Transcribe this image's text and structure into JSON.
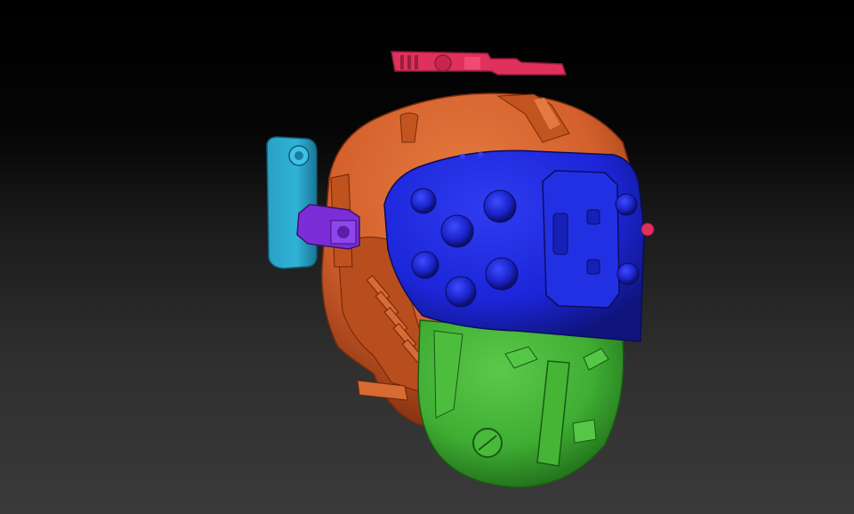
{
  "scene": {
    "colors": {
      "shell_orange": "#d4612c",
      "visor_blue": "#1c25d8",
      "face_green": "#3fae33",
      "antenna_pink": "#e0305c",
      "side_cyan": "#2fb3d6",
      "side_purple": "#7b2ed8",
      "background_top": "#000000",
      "background_bottom": "#3a3a3a"
    }
  }
}
